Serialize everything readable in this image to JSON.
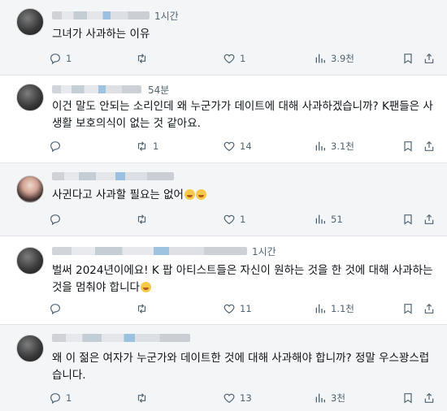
{
  "tweets": [
    {
      "time": "1시간",
      "text": "그녀가 사과하는 이유",
      "replies": "1",
      "retweets": "",
      "likes": "1",
      "views": "3.9천",
      "has_emoji": false
    },
    {
      "time": "54분",
      "text": "이건 말도 안되는 소리인데 왜 누군가가 데이트에 대해 사과하겠습니까? K팬들은 사생활 보호의식이 없는 것 같아요.",
      "replies": "",
      "retweets": "1",
      "likes": "14",
      "views": "3.1천",
      "has_emoji": false
    },
    {
      "time": "",
      "text": "사귄다고 사과할 필요는 없어",
      "replies": "",
      "retweets": "",
      "likes": "1",
      "views": "51",
      "has_emoji": true,
      "emoji_count": 2
    },
    {
      "time": "1시간",
      "text": "벌써 2024년이에요! K 팝 아티스트들은 자신이 원하는 것을 한 것에 대해 사과하는 것을 멈춰야 합니다",
      "replies": "",
      "retweets": "",
      "likes": "11",
      "views": "1.1천",
      "has_emoji": true,
      "emoji_count": 1
    },
    {
      "time": "",
      "text": "왜 이 젊은 여자가 누군가와 데이트한 것에 대해 사과해야 합니까? 정말 우스꽝스럽습니다.",
      "replies": "1",
      "retweets": "",
      "likes": "13",
      "views": "3천",
      "has_emoji": false
    }
  ],
  "colors": {
    "text": "#0f1419",
    "muted": "#536471",
    "shade": "#f4f5f6"
  },
  "icons": [
    "reply-icon",
    "retweet-icon",
    "like-icon",
    "views-icon",
    "bookmark-icon"
  ]
}
